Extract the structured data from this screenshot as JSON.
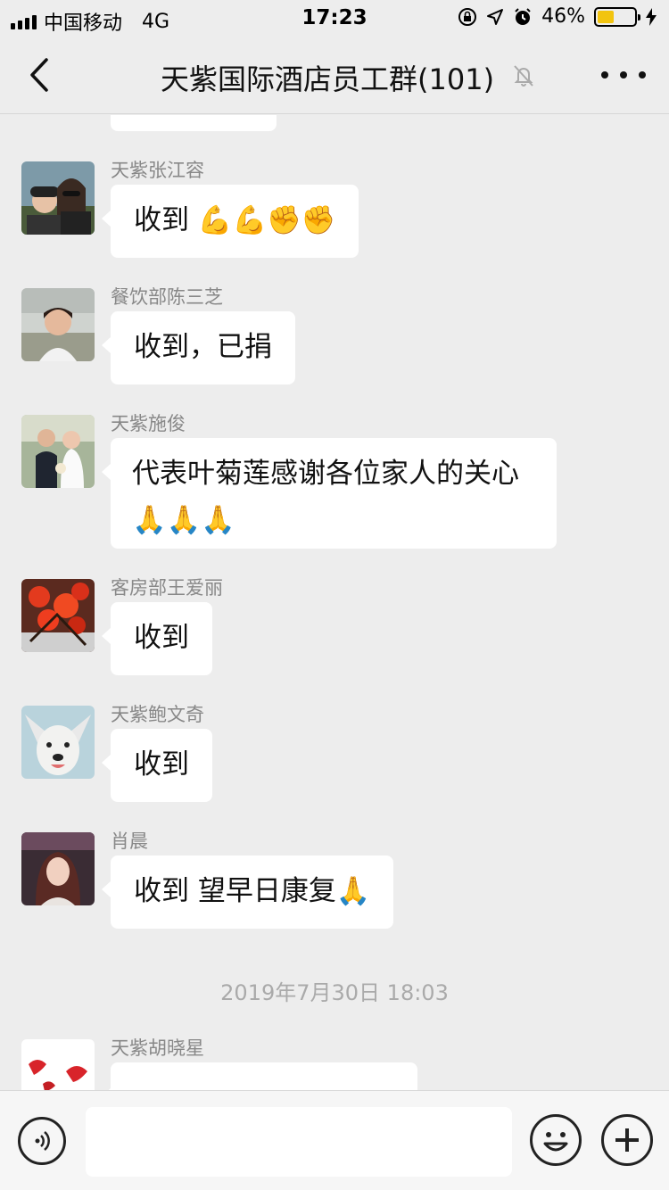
{
  "status_bar": {
    "carrier": "中国移动",
    "network": "4G",
    "time": "17:23",
    "battery": "46%",
    "battery_level": 0.46
  },
  "nav": {
    "title": "天紫国际酒店员工群(101)",
    "back_icon": "chevron-left-icon",
    "mute_icon": "bell-off-icon",
    "more_icon": "ellipsis-icon"
  },
  "messages": [
    {
      "sender": "天紫张江容",
      "text": "收到 ",
      "emoji": "💪💪✊✊"
    },
    {
      "sender": "餐饮部陈三芝",
      "text": "收到，已捐",
      "emoji": ""
    },
    {
      "sender": "天紫施俊",
      "text": "代表叶菊莲感谢各位家人的关心",
      "emoji": "🙏🙏🙏"
    },
    {
      "sender": "客房部王爱丽",
      "text": "收到",
      "emoji": ""
    },
    {
      "sender": "天紫鲍文奇",
      "text": "收到",
      "emoji": ""
    },
    {
      "sender": "肖晨",
      "text": "收到 望早日康复",
      "emoji": "🙏"
    },
    {
      "sender": "天紫胡晓星",
      "text": "",
      "emoji": ""
    }
  ],
  "timestamp": "2019年7月30日 18:03",
  "input": {
    "placeholder": ""
  },
  "colors": {
    "background": "#ededed",
    "bubble": "#ffffff",
    "battery": "#f2c40f"
  }
}
